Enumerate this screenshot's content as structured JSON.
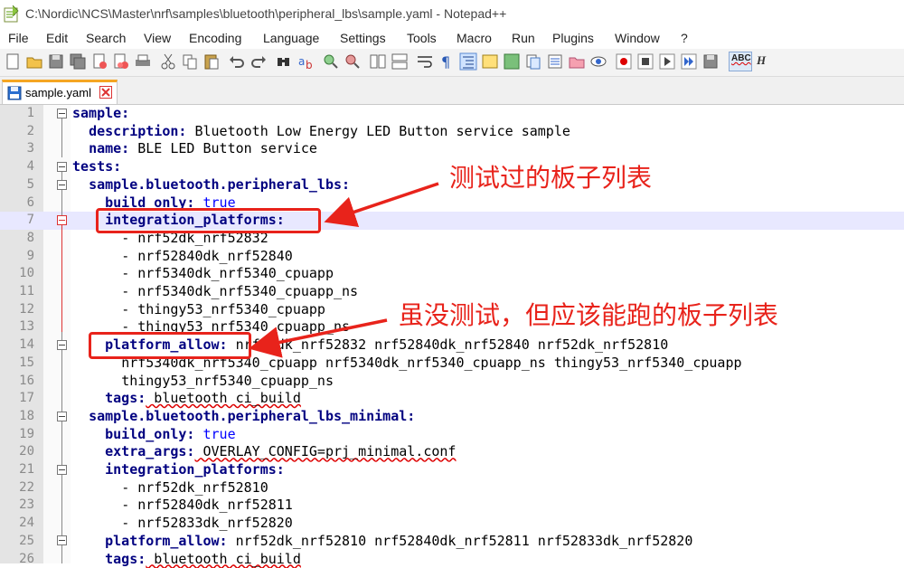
{
  "window": {
    "title": "C:\\Nordic\\NCS\\Master\\nrf\\samples\\bluetooth\\peripheral_lbs\\sample.yaml - Notepad++"
  },
  "menu": [
    "File",
    "Edit",
    "Search",
    "View",
    "Encoding",
    "Language",
    "Settings",
    "Tools",
    "Macro",
    "Run",
    "Plugins",
    "Window",
    "?"
  ],
  "toolbar": {
    "spellcheck_label": "ABC",
    "h_label": "H"
  },
  "tab": {
    "label": "sample.yaml"
  },
  "editor": {
    "lines": [
      {
        "n": "1",
        "key": "sample:",
        "val": ""
      },
      {
        "n": "2",
        "key": "description:",
        "val": " Bluetooth Low Energy LED Button service sample"
      },
      {
        "n": "3",
        "key": "name:",
        "val": " BLE LED Button service"
      },
      {
        "n": "4",
        "key": "tests:",
        "val": ""
      },
      {
        "n": "5",
        "key": "sample.bluetooth.peripheral_lbs:",
        "val": ""
      },
      {
        "n": "6",
        "key": "build_only:",
        "val": " true"
      },
      {
        "n": "7",
        "key": "integration_platforms:",
        "val": ""
      },
      {
        "n": "8",
        "key": "",
        "val": "- nrf52dk_nrf52832"
      },
      {
        "n": "9",
        "key": "",
        "val": "- nrf52840dk_nrf52840"
      },
      {
        "n": "10",
        "key": "",
        "val": "- nrf5340dk_nrf5340_cpuapp"
      },
      {
        "n": "11",
        "key": "",
        "val": "- nrf5340dk_nrf5340_cpuapp_ns"
      },
      {
        "n": "12",
        "key": "",
        "val": "- thingy53_nrf5340_cpuapp"
      },
      {
        "n": "13",
        "key": "",
        "val": "- thingy53_nrf5340_cpuapp_ns"
      },
      {
        "n": "14",
        "key": "platform_allow:",
        "val": " nrf52dk_nrf52832 nrf52840dk_nrf52840 nrf52dk_nrf52810"
      },
      {
        "n": "15",
        "key": "",
        "val": "nrf5340dk_nrf5340_cpuapp nrf5340dk_nrf5340_cpuapp_ns thingy53_nrf5340_cpuapp"
      },
      {
        "n": "16",
        "key": "",
        "val": "thingy53_nrf5340_cpuapp_ns"
      },
      {
        "n": "17",
        "key": "tags:",
        "val": " bluetooth ci_build"
      },
      {
        "n": "18",
        "key": "sample.bluetooth.peripheral_lbs_minimal:",
        "val": ""
      },
      {
        "n": "19",
        "key": "build_only:",
        "val": " true"
      },
      {
        "n": "20",
        "key": "extra_args:",
        "val": " OVERLAY_CONFIG=prj_minimal.conf"
      },
      {
        "n": "21",
        "key": "integration_platforms:",
        "val": ""
      },
      {
        "n": "22",
        "key": "",
        "val": "- nrf52dk_nrf52810"
      },
      {
        "n": "23",
        "key": "",
        "val": "- nrf52840dk_nrf52811"
      },
      {
        "n": "24",
        "key": "",
        "val": "- nrf52833dk_nrf52820"
      },
      {
        "n": "25",
        "key": "platform_allow:",
        "val": " nrf52dk_nrf52810 nrf52840dk_nrf52811 nrf52833dk_nrf52820"
      },
      {
        "n": "26",
        "key": "tags:",
        "val": " bluetooth ci_build"
      }
    ]
  },
  "annotations": {
    "tested_boards": "测试过的板子列表",
    "untested_boards": "虽没测试，但应该能跑的板子列表"
  },
  "colors": {
    "annotation": "#e8231b",
    "key": "#000080",
    "boolean": "#0000ff"
  }
}
